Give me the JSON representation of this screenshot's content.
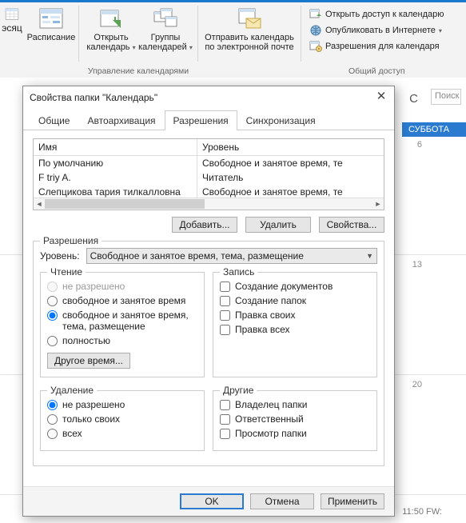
{
  "ribbon": {
    "month": "эсяц",
    "schedule": "Расписание",
    "open_calendar": "Открыть календарь",
    "calendar_groups": "Группы календарей",
    "send_email": "Отправить календарь по электронной почте",
    "group_manage": "Управление календарями",
    "share_open": "Открыть доступ к календарю",
    "share_publish": "Опубликовать в Интернете",
    "share_perms": "Разрешения для календаря",
    "group_share": "Общий доступ"
  },
  "calendar": {
    "search_placeholder": "Поиск",
    "letter": "С",
    "saturday": "СУББОТА",
    "d1": "6",
    "d2": "13",
    "d3": "20",
    "bottom_time": "11:50 FW:"
  },
  "dialog": {
    "title": "Свойства папки \"Календарь\"",
    "tabs": {
      "general": "Общие",
      "autoarchive": "Автоархивация",
      "permissions": "Разрешения",
      "sync": "Синхронизация"
    },
    "cols": {
      "name": "Имя",
      "level": "Уровень"
    },
    "rows": [
      {
        "name": "По умолчанию",
        "level": "Свободное и занятое время, те"
      },
      {
        "name": "F                  triy A.",
        "level": "Читатель"
      },
      {
        "name": "Слепцикова тария тилкалловна",
        "level": "Свободное и занятое время, те"
      }
    ],
    "btn_add": "Добавить...",
    "btn_remove": "Удалить",
    "btn_props": "Свойства...",
    "perm_legend": "Разрешения",
    "level_label": "Уровень:",
    "level_value": "Свободное и занятое время, тема, размещение",
    "read": {
      "legend": "Чтение",
      "none": "не разрешено",
      "freebusy": "свободное и занятое время",
      "freebusy_subj": "свободное и занятое время, тема, размещение",
      "full": "полностью",
      "other_time": "Другое время..."
    },
    "write": {
      "legend": "Запись",
      "create_items": "Создание документов",
      "create_folders": "Создание папок",
      "edit_own": "Правка своих",
      "edit_all": "Правка всех"
    },
    "delete": {
      "legend": "Удаление",
      "none": "не разрешено",
      "own": "только своих",
      "all": "всех"
    },
    "other": {
      "legend": "Другие",
      "owner": "Владелец папки",
      "responsible": "Ответственный",
      "view": "Просмотр папки"
    },
    "ok": "OK",
    "cancel": "Отмена",
    "apply": "Применить"
  }
}
